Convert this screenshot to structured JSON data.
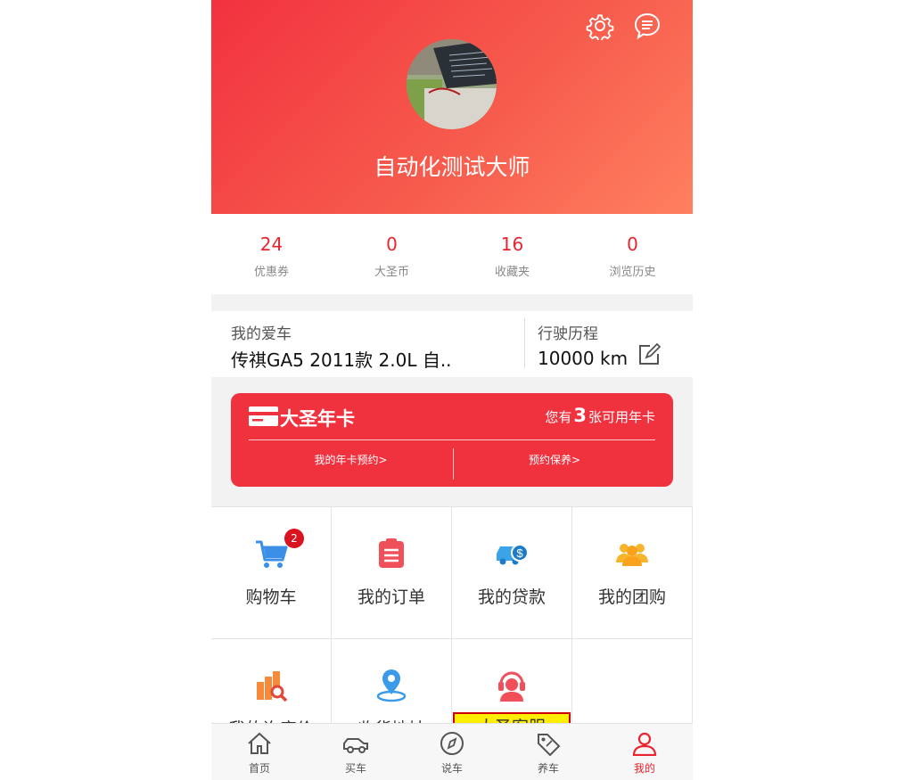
{
  "header": {
    "username": "自动化测试大师",
    "settings_icon": "gear-icon",
    "message_icon": "chat-bubble-icon"
  },
  "stats": [
    {
      "value": "24",
      "label": "优惠券"
    },
    {
      "value": "0",
      "label": "大圣币"
    },
    {
      "value": "16",
      "label": "收藏夹"
    },
    {
      "value": "0",
      "label": "浏览历史"
    }
  ],
  "car": {
    "title": "我的爱车",
    "model": "传祺GA5 2011款 2.0L 自..",
    "mileage_title": "行驶历程",
    "mileage": "10000  km"
  },
  "annual_card": {
    "title": "大圣年卡",
    "available_prefix": "您有",
    "available_count": "3",
    "available_suffix": "张可用年卡",
    "link_reserve": "我的年卡预约>",
    "link_maintenance": "预约保养>"
  },
  "grid": [
    {
      "label": "购物车",
      "icon": "shopping-cart-icon",
      "badge": "2"
    },
    {
      "label": "我的订单",
      "icon": "clipboard-icon"
    },
    {
      "label": "我的贷款",
      "icon": "car-loan-icon"
    },
    {
      "label": "我的团购",
      "icon": "group-icon"
    },
    {
      "label": "我的询底价",
      "icon": "price-search-icon"
    },
    {
      "label": "收货地址",
      "icon": "location-pin-icon"
    },
    {
      "label": "大圣客服",
      "icon": "customer-service-icon"
    }
  ],
  "tabbar": [
    {
      "label": "首页",
      "icon": "home-icon"
    },
    {
      "label": "买车",
      "icon": "car-icon"
    },
    {
      "label": "说车",
      "icon": "compass-icon"
    },
    {
      "label": "养车",
      "icon": "tag-icon"
    },
    {
      "label": "我的",
      "icon": "user-icon",
      "active": true
    }
  ],
  "colors": {
    "brand_red": "#f0323f",
    "accent_red": "#e8242f"
  }
}
